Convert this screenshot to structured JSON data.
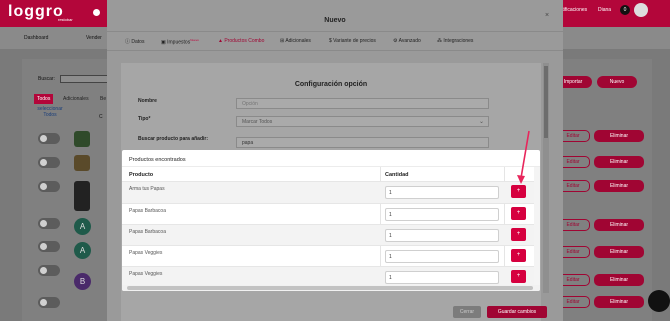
{
  "app": {
    "logo": "loggro",
    "logo_sub": "restobar",
    "notifications": "Notificaciones",
    "user_badge": "0",
    "user_name": "Diana"
  },
  "subnav": {
    "dashboard": "Dashboard",
    "vender": "Vender"
  },
  "background": {
    "search_label": "Buscar:",
    "tabs": [
      "Todos",
      "Adicionales",
      "Be"
    ],
    "select_all": "seleccionar Todos",
    "col_hint": "C",
    "letters": [
      "A",
      "A",
      "B"
    ],
    "import_label": "Importar",
    "new_label": "Nuevo",
    "edit_label": "Editar",
    "delete_label": "Eliminar"
  },
  "modal": {
    "title": "Nuevo",
    "close": "×",
    "tabs": [
      {
        "label": "Datos",
        "icon": "info-icon",
        "badge": ""
      },
      {
        "label": "Impuestos",
        "icon": "money-icon",
        "badge": "Nuevo"
      },
      {
        "label": "Productos Combo",
        "icon": "bag-icon",
        "badge": ""
      },
      {
        "label": "Adicionales",
        "icon": "plus-box-icon",
        "badge": ""
      },
      {
        "label": "Variante de precios",
        "icon": "dollar-icon",
        "badge": ""
      },
      {
        "label": "Avanzado",
        "icon": "gear-icon",
        "badge": ""
      },
      {
        "label": "Integraciones",
        "icon": "grid-icon",
        "badge": ""
      }
    ],
    "config_title": "Configuración opción",
    "fields": {
      "name_label": "Nombre",
      "name_placeholder": "Opción",
      "type_label": "Tipo*",
      "type_value": "Marcar Todos",
      "search_label": "Buscar producto para añadir:",
      "search_value": "papa"
    },
    "cancel_label": "Cerrar",
    "save_label": "Guardar cambios"
  },
  "popup": {
    "title": "Productos encontrados",
    "columns": [
      "Producto",
      "Cantidad"
    ],
    "rows": [
      {
        "product": "Arma tus Papas",
        "qty": "1"
      },
      {
        "product": "Papas Barbacoa",
        "qty": "1"
      },
      {
        "product": "Papas Barbacoa",
        "qty": "1"
      },
      {
        "product": "Papas Veggies",
        "qty": "1"
      },
      {
        "product": "Papas Veggies",
        "qty": "1"
      }
    ],
    "add_symbol": "+"
  },
  "colors": {
    "brand": "#b3063a",
    "add_button": "#d6003f",
    "arrow": "#e8265c"
  }
}
